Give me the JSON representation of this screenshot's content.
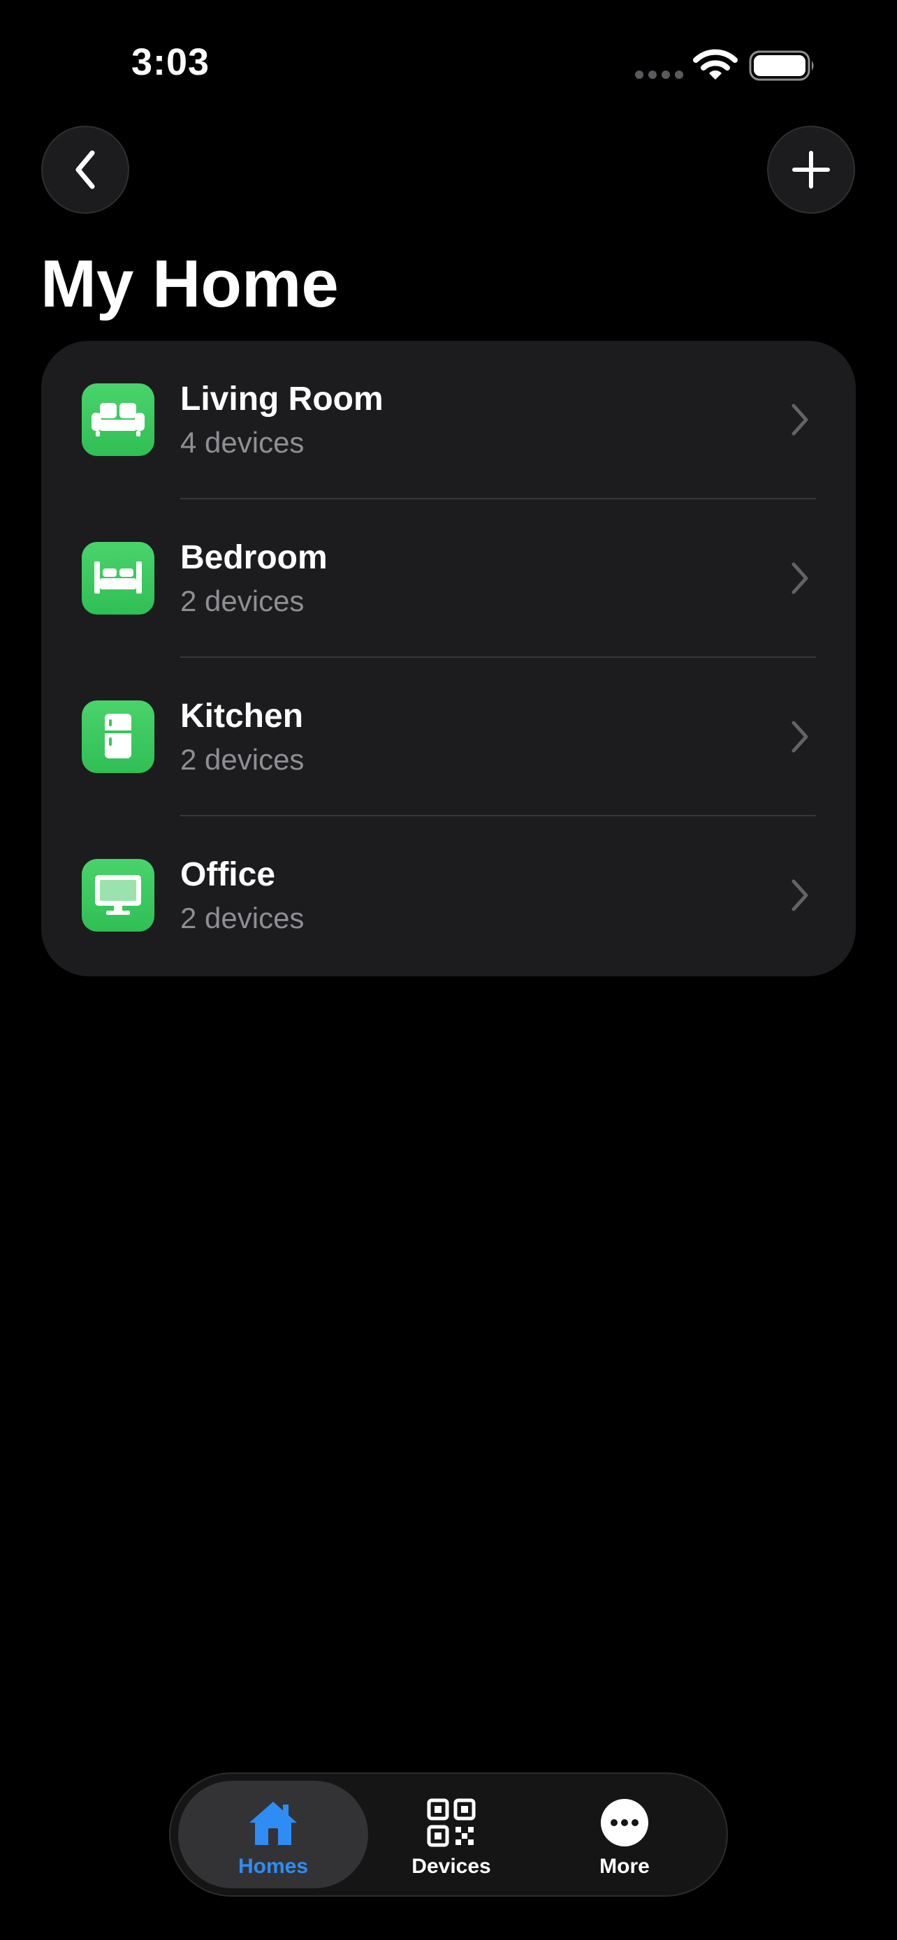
{
  "status_bar": {
    "time": "3:03"
  },
  "header": {
    "title": "My Home",
    "back_icon": "chevron-left-icon",
    "add_icon": "plus-icon"
  },
  "rooms": [
    {
      "name": "Living Room",
      "devices": "4 devices",
      "icon": "sofa-icon"
    },
    {
      "name": "Bedroom",
      "devices": "2 devices",
      "icon": "bed-icon"
    },
    {
      "name": "Kitchen",
      "devices": "2 devices",
      "icon": "refrigerator-icon"
    },
    {
      "name": "Office",
      "devices": "2 devices",
      "icon": "desktop-icon"
    }
  ],
  "tab_bar": {
    "tabs": [
      {
        "label": "Homes",
        "icon": "house-icon",
        "active": true
      },
      {
        "label": "Devices",
        "icon": "qr-code-icon",
        "active": false
      },
      {
        "label": "More",
        "icon": "more-icon",
        "active": false
      }
    ]
  },
  "colors": {
    "background": "#000000",
    "card": "#1c1c1e",
    "room_icon_green": "#34c759",
    "secondary_text": "#8e8e93",
    "active_tab": "#2f8cf4"
  }
}
